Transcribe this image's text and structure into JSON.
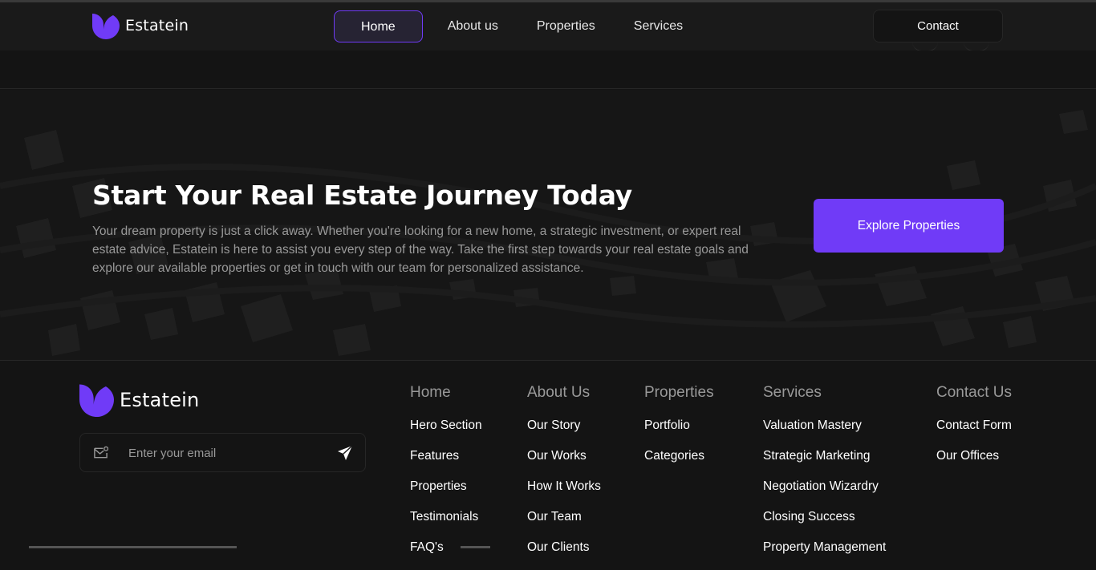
{
  "nav": {
    "brand": "Estatein",
    "links": [
      {
        "label": "Home",
        "active": true
      },
      {
        "label": "About us"
      },
      {
        "label": "Properties"
      },
      {
        "label": "Services"
      }
    ],
    "contact_label": "Contact"
  },
  "cta": {
    "title": "Start Your Real Estate Journey Today",
    "description": "Your dream property is just a click away. Whether you're looking for a new home, a strategic investment, or expert real estate advice, Estatein is here to assist you every step of the way. Take the first step towards your real estate goals and explore our available properties or get in touch with our team for personalized assistance.",
    "button_label": "Explore Properties"
  },
  "footer": {
    "brand": "Estatein",
    "email_placeholder": "Enter your email",
    "columns": [
      {
        "title": "Home",
        "links": [
          "Hero Section",
          "Features",
          "Properties",
          "Testimonials",
          "FAQ's"
        ]
      },
      {
        "title": "About Us",
        "links": [
          "Our Story",
          "Our Works",
          "How It Works",
          "Our Team",
          "Our Clients"
        ]
      },
      {
        "title": "Properties",
        "links": [
          "Portfolio",
          "Categories"
        ]
      },
      {
        "title": "Services",
        "links": [
          "Valuation Mastery",
          "Strategic Marketing",
          "Negotiation Wizardry",
          "Closing Success",
          "Property Management"
        ]
      },
      {
        "title": "Contact Us",
        "links": [
          "Contact Form",
          "Our Offices"
        ]
      }
    ]
  },
  "colors": {
    "accent": "#703bf7",
    "background": "#141414",
    "muted_text": "#999999"
  },
  "icons": [
    "logo-icon",
    "mail-icon",
    "send-icon"
  ]
}
